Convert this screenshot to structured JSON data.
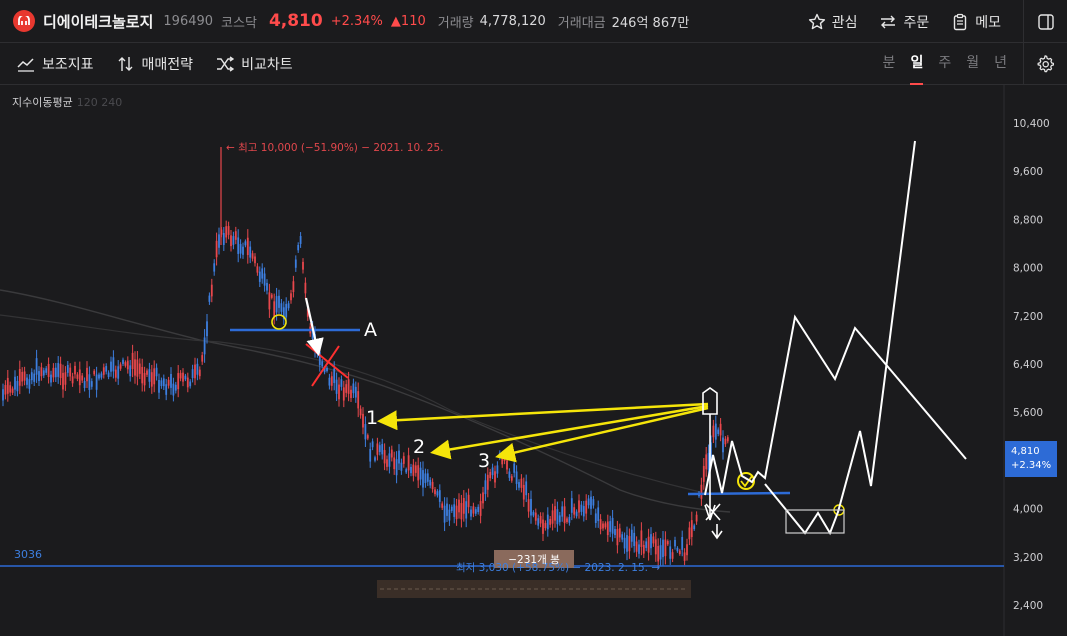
{
  "header": {
    "stock_name": "디에이테크놀로지",
    "stock_code": "196490",
    "market": "코스닥",
    "price": "4,810",
    "change_pct": "+2.34%",
    "change_amt": "▲110",
    "volume_label": "거래량",
    "volume_value": "4,778,120",
    "amount_label": "거래대금",
    "amount_value": "246억 867만",
    "actions": {
      "watch": "관심",
      "order": "주문",
      "memo": "메모"
    }
  },
  "toolbar": {
    "indicator": "보조지표",
    "strategy": "매매전략",
    "compare": "비교차트",
    "periods": [
      "분",
      "일",
      "주",
      "월",
      "년"
    ],
    "active_period": "일"
  },
  "chart_data": {
    "type": "candlestick",
    "indicator_label": "지수이동평균",
    "indicator_params": "120 240",
    "y_ticks": [
      "10,400",
      "9,600",
      "8,800",
      "8,000",
      "7,200",
      "6,400",
      "5,600",
      "4,800",
      "4,000",
      "3,200",
      "2,400"
    ],
    "ylim": [
      2400,
      10400
    ],
    "high_annotation": "← 최고 10,000 (−51.90%) − 2021. 10. 25.",
    "low_annotation": "최저 3,030 (+58.75%) − 2023. 2. 15. →",
    "bar_count_label": "−231개 봉",
    "support_line_label": "3036",
    "support_line_value": 3036,
    "current_price_badge": "4,810",
    "current_change_badge": "+2.34%",
    "drawn_labels": [
      "A",
      "1",
      "2",
      "3"
    ],
    "colors": {
      "up": "#e8474c",
      "down": "#3d7fe0",
      "support": "#2d6bd6",
      "arrow": "#f5e50a"
    }
  }
}
